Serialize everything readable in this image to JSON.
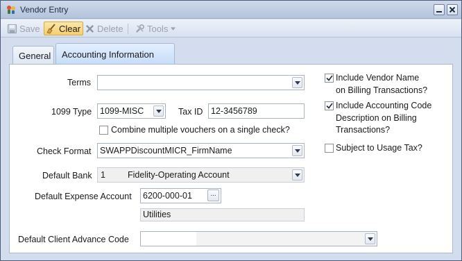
{
  "window": {
    "title": "Vendor Entry"
  },
  "toolbar": {
    "save_label": "Save",
    "clear_label": "Clear",
    "delete_label": "Delete",
    "tools_label": "Tools"
  },
  "tabs": [
    {
      "label": "General",
      "active": false
    },
    {
      "label": "Accounting Information",
      "active": true
    }
  ],
  "form": {
    "terms": {
      "label": "Terms",
      "value": ""
    },
    "type1099": {
      "label": "1099 Type",
      "value": "1099-MISC"
    },
    "tax_id": {
      "label": "Tax ID",
      "value": "12-3456789"
    },
    "combine": {
      "label": "Combine multiple vouchers on a single check?",
      "checked": false
    },
    "check_format": {
      "label": "Check Format",
      "value": "SWAPPDiscountMICR_FirmName"
    },
    "default_bank": {
      "label": "Default Bank",
      "code": "1",
      "name": "Fidelity-Operating Account"
    },
    "expense_account": {
      "label": "Default Expense Account",
      "value": "6200-000-01",
      "button": "...",
      "description": "Utilities"
    },
    "client_advance": {
      "label": "Default Client Advance Code",
      "value": ""
    }
  },
  "options": [
    {
      "line1": "Include Vendor Name",
      "line2": "on Billing Transactions?",
      "line3": "",
      "checked": true
    },
    {
      "line1": "Include Accounting Code",
      "line2": "Description on Billing",
      "line3": "Transactions?",
      "checked": true
    },
    {
      "line1": "Subject to Usage Tax?",
      "line2": "",
      "line3": "",
      "checked": false
    }
  ],
  "icons": {
    "app": "vendor-app-icon",
    "save": "save-icon",
    "clear": "broom-icon",
    "delete": "delete-x-icon",
    "tools": "tools-icon"
  }
}
